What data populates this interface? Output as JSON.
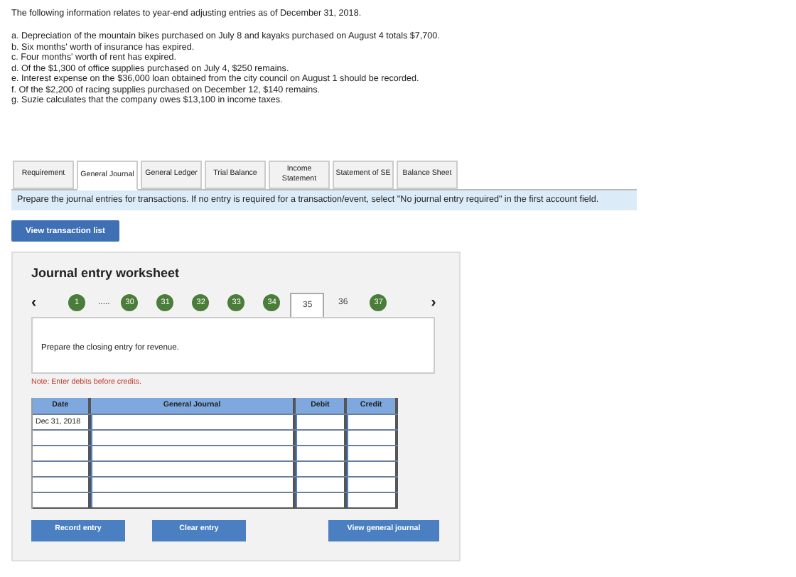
{
  "intro": "The following information relates to year-end adjusting entries as of December 31, 2018.",
  "items": [
    "a. Depreciation of the mountain bikes purchased on July 8 and kayaks purchased on August 4 totals $7,700.",
    "b. Six months' worth of insurance has expired.",
    "c. Four months' worth of rent has expired.",
    "d. Of the $1,300 of office supplies purchased on July 4, $250 remains.",
    "e. Interest expense on the $36,000 loan obtained from the city council on August 1 should be recorded.",
    "f. Of the $2,200 of racing supplies purchased on December 12, $140 remains.",
    "g. Suzie calculates that the company owes $13,100 in income taxes."
  ],
  "tabs": [
    {
      "label": "Requirement",
      "selected": false
    },
    {
      "label": "General Journal",
      "selected": true
    },
    {
      "label": "General Ledger",
      "selected": false
    },
    {
      "label": "Trial Balance",
      "selected": false
    },
    {
      "label": "Income Statement",
      "selected": false
    },
    {
      "label": "Statement of SE",
      "selected": false
    },
    {
      "label": "Balance Sheet",
      "selected": false
    }
  ],
  "instructions": "Prepare the journal entries for transactions. If no entry is required for a transaction/event, select \"No journal entry required\" in the first account field.",
  "view_transactions_button": "View transaction list",
  "worksheet": {
    "title": "Journal entry worksheet",
    "prev": "‹",
    "next": "›",
    "pager": [
      {
        "kind": "done",
        "label": "1",
        "selected": false
      },
      {
        "kind": "gap",
        "label": "....."
      },
      {
        "kind": "done",
        "label": "30",
        "selected": false
      },
      {
        "kind": "done",
        "label": "31",
        "selected": false
      },
      {
        "kind": "done",
        "label": "32",
        "selected": false
      },
      {
        "kind": "done",
        "label": "33",
        "selected": false
      },
      {
        "kind": "done",
        "label": "34",
        "selected": false
      },
      {
        "kind": "plain",
        "label": "35",
        "selected": true
      },
      {
        "kind": "plain",
        "label": "36",
        "selected": false
      },
      {
        "kind": "done",
        "label": "37",
        "selected": false
      }
    ],
    "prompt": "Prepare the closing entry for revenue.",
    "note": "Note: Enter debits before credits.",
    "columns": [
      "Date",
      "General Journal",
      "Debit",
      "Credit"
    ],
    "rows": [
      {
        "date": "Dec 31, 2018"
      },
      {},
      {},
      {},
      {},
      {}
    ],
    "buttons": [
      "Record entry",
      "Clear entry",
      "View general journal"
    ]
  }
}
